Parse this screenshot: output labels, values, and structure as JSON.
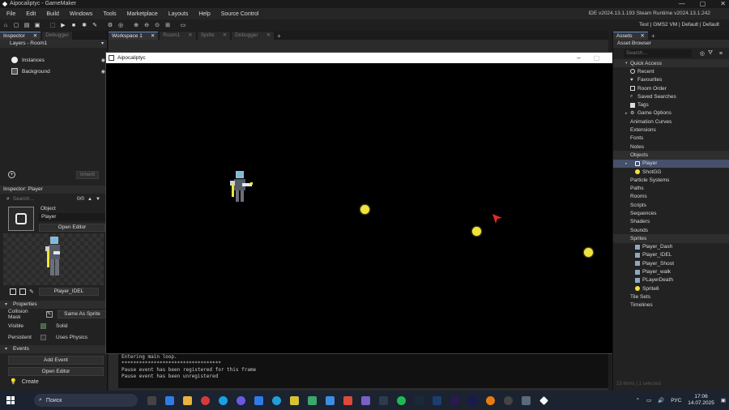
{
  "window": {
    "title": "Aipocaliptyc - GameMaker",
    "minimize": "—",
    "maximize": "▢",
    "close": "✕"
  },
  "menu": {
    "items": [
      "File",
      "Edit",
      "Build",
      "Windows",
      "Tools",
      "Marketplace",
      "Layouts",
      "Help",
      "Source Control"
    ],
    "ide_version": "IDE v2024.13.1.193 Steam  Runtime v2024.13.1.242"
  },
  "toolbar": {
    "target_info": "Test  |  GMS2 VM  |  Default  |  Default"
  },
  "left_panel": {
    "tabs": [
      {
        "label": "Inspector",
        "active": true
      },
      {
        "label": "Debugger",
        "active": false
      }
    ],
    "layers_title": "Layers - Room1",
    "layers": [
      {
        "name": "Instances",
        "icon": "instances-icon"
      },
      {
        "name": "Background",
        "icon": "background-icon"
      }
    ],
    "inherit_label": "Inherit",
    "inspector_title": "Inspector: Player",
    "search_placeholder": "Search...",
    "search_count": "0/0",
    "object_heading": "Object",
    "object_name": "Player",
    "open_editor": "Open Editor",
    "sprite_name": "Player_IDEL",
    "properties_title": "Properties",
    "collision_mask_label": "Collision Mask",
    "collision_mask_value": "Same As Sprite",
    "visible_label": "Visible",
    "visible_checked": true,
    "solid_label": "Solid",
    "solid_checked": false,
    "persistent_label": "Persistent",
    "persistent_checked": false,
    "uses_physics_label": "Uses Physics",
    "uses_physics_checked": false,
    "events_title": "Events",
    "add_event": "Add Event",
    "open_editor_events": "Open Editor",
    "create_event": "Create"
  },
  "workspace": {
    "tabs": [
      {
        "label": "Workspace 1",
        "active": true
      },
      {
        "label": "Room1",
        "active": false
      },
      {
        "label": "Sprite",
        "active": false
      },
      {
        "label": "Debugger",
        "active": false
      }
    ]
  },
  "game_window": {
    "title": "Aipocaliptyc"
  },
  "output": {
    "lines": [
      "Entering main loop.",
      "**********************************",
      "Pause event has been registered for this frame",
      "Pause event has been unregistered"
    ]
  },
  "right_panel": {
    "tab": "Assets",
    "title": "Asset Browser",
    "search_placeholder": "Search...",
    "quick_access": "Quick Access",
    "quick_items": [
      {
        "label": "Recent",
        "icon": "recent-icon"
      },
      {
        "label": "Favourites",
        "icon": "heart-icon"
      },
      {
        "label": "Room Order",
        "icon": "room-order-icon"
      },
      {
        "label": "Saved Searches",
        "icon": "saved-search-icon"
      },
      {
        "label": "Tags",
        "icon": "tag-icon"
      },
      {
        "label": "Game Options",
        "icon": "gear-icon"
      }
    ],
    "groups_a": [
      "Animation Curves",
      "Extensions",
      "Fonts",
      "Notes"
    ],
    "objects_folder": "Objects",
    "objects": [
      "Player",
      "ShotGG"
    ],
    "groups_b": [
      "Particle Systems",
      "Paths",
      "Rooms",
      "Scripts",
      "Sequences",
      "Shaders",
      "Sounds"
    ],
    "sprites_folder": "Sprites",
    "sprites": [
      "Player_Dash",
      "Player_IDEL",
      "Player_Shoot",
      "Player_walk",
      "PLayerDeath",
      "Sprite6"
    ],
    "groups_c": [
      "Tile Sets",
      "Timelines"
    ],
    "footer": "23 items  |  1 selected"
  },
  "taskbar": {
    "search_label": "Поиск",
    "language": "РУС",
    "time": "17:06",
    "date": "14.07.2025"
  },
  "colors": {
    "accent": "#5b8bd6",
    "selection": "#46506b",
    "coin": "#f2e33a",
    "arrow": "#e02a2a"
  }
}
